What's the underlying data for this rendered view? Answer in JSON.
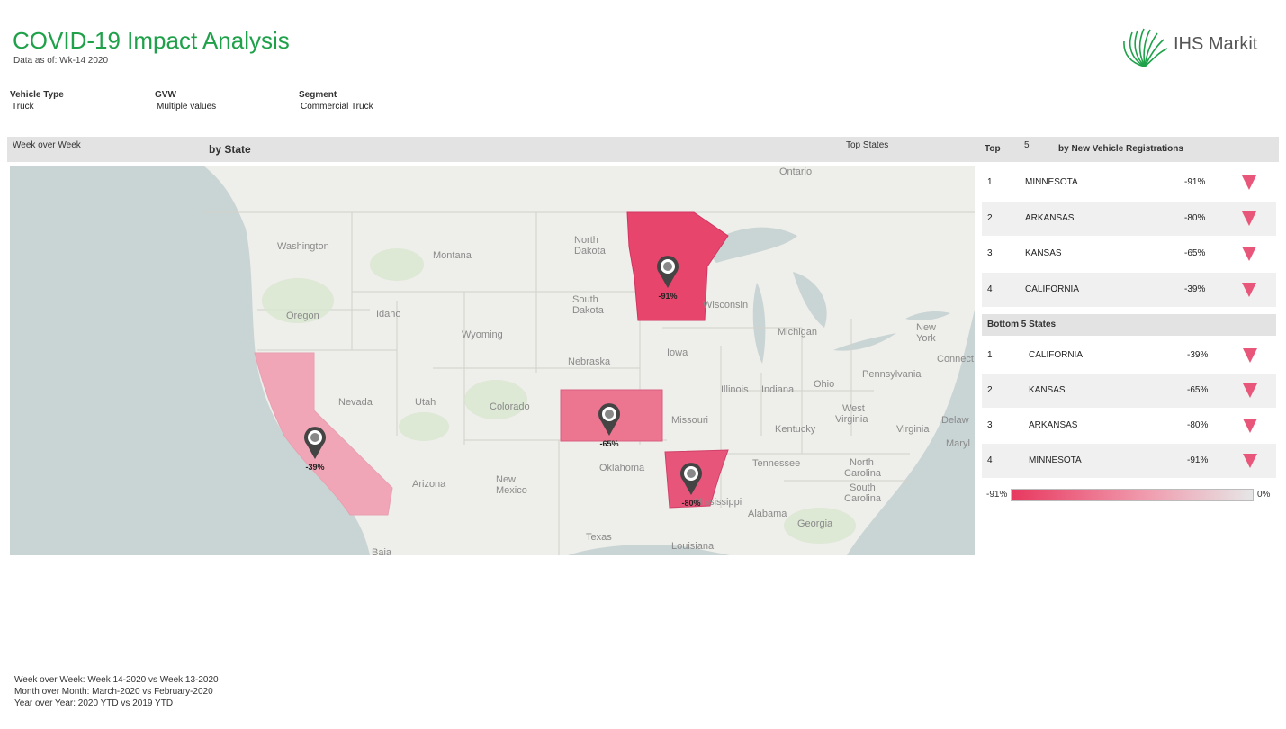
{
  "header": {
    "title": "COVID-19 Impact Analysis",
    "as_of": "Data as of: Wk-14 2020",
    "logo_text": "IHS Markit",
    "brand_color": "#1fa14a"
  },
  "filters": [
    {
      "label": "Vehicle Type",
      "value": "Truck"
    },
    {
      "label": "GVW",
      "value": "Multiple values"
    },
    {
      "label": "Segment",
      "value": "Commercial Truck"
    }
  ],
  "bar": {
    "period": "Week over Week",
    "by": "by State",
    "top_states": "Top States",
    "top": "Top",
    "top_n": "5",
    "by_reg": "by New Vehicle Registrations"
  },
  "map": {
    "labels": [
      "Ontario",
      "Washington",
      "Montana",
      "North",
      "Dakota",
      "South",
      "Dakota",
      "Oregon",
      "Idaho",
      "Wyoming",
      "Nebraska",
      "Iowa",
      "Wisconsin",
      "Michigan",
      "New",
      "York",
      "Nevada",
      "Utah",
      "Colorado",
      "Illinois",
      "Indiana",
      "Ohio",
      "Pennsylvania",
      "Connect",
      "Missouri",
      "West",
      "Virginia",
      "Virginia",
      "Kentucky",
      "Oklahoma",
      "Tennessee",
      "North",
      "Carolina",
      "South",
      "Carolina",
      "Arizona",
      "New",
      "Mexico",
      "Mississippi",
      "Alabama",
      "Georgia",
      "Texas",
      "Louisiana",
      "Baja",
      "Delaw",
      "Maryl"
    ],
    "pins": [
      {
        "state": "Minnesota",
        "label": "-91%",
        "value": -91
      },
      {
        "state": "Kansas",
        "label": "-65%",
        "value": -65
      },
      {
        "state": "Arkansas",
        "label": "-80%",
        "value": -80
      },
      {
        "state": "California",
        "label": "-39%",
        "value": -39
      }
    ],
    "colors": {
      "water": "#c9d4d4",
      "land": "#eeeeea",
      "high": "#e8456d",
      "mid": "#ec7590",
      "low": "#f0a6b6"
    }
  },
  "top": [
    {
      "rank": "1",
      "state": "MINNESOTA",
      "pct": "-91%"
    },
    {
      "rank": "2",
      "state": "ARKANSAS",
      "pct": "-80%"
    },
    {
      "rank": "3",
      "state": "KANSAS",
      "pct": "-65%"
    },
    {
      "rank": "4",
      "state": "CALIFORNIA",
      "pct": "-39%"
    }
  ],
  "bottom_title": "Bottom 5 States",
  "bottom": [
    {
      "rank": "1",
      "state": "CALIFORNIA",
      "pct": "-39%"
    },
    {
      "rank": "2",
      "state": "KANSAS",
      "pct": "-65%"
    },
    {
      "rank": "3",
      "state": "ARKANSAS",
      "pct": "-80%"
    },
    {
      "rank": "4",
      "state": "MINNESOTA",
      "pct": "-91%"
    }
  ],
  "legend": {
    "min": "-91%",
    "max": "0%"
  },
  "footer": [
    "Week over Week: Week 14-2020 vs Week 13-2020",
    "Month over Month: March-2020 vs February-2020",
    "Year over Year: 2020 YTD vs 2019 YTD"
  ]
}
